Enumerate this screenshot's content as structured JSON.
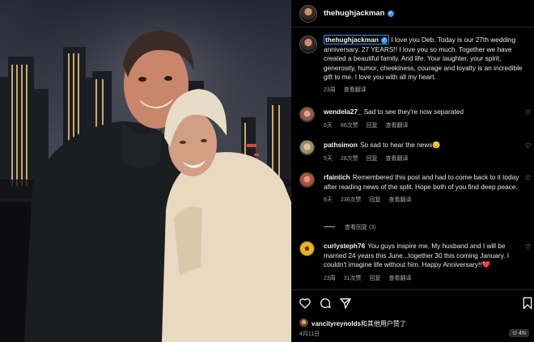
{
  "post": {
    "username": "thehughjackman",
    "caption": " I love you Deb. Today is our 27th wedding anniversary. 27 YEARS!! I love you so much. Together we have created a beautiful family. And life. Your laughter, your spirit, generosity, humor, cheekiness, courage and loyalty is an incredible gift to me. I love you with all my heart.",
    "caption_time": "23周",
    "caption_translate": "查看翻译"
  },
  "comments": [
    {
      "user": "wendela27_",
      "text": "Sad to see they're now separated",
      "time": "6天",
      "likes": "86次赞",
      "reply": "回复",
      "translate": "查看翻译"
    },
    {
      "user": "pathsimon",
      "text": "So sad to hear the news😔",
      "time": "5天",
      "likes": "28次赞",
      "reply": "回复",
      "translate": "查看翻译"
    },
    {
      "user": "rfaintich",
      "text": "Remembered this post and had to come back to it today after reading news of the split. Hope both of you find deep peace.",
      "time": "6天",
      "likes": "236次赞",
      "reply": "回复",
      "translate": "查看翻译"
    },
    {
      "user": "curlysteph76",
      "text": "You guys inspire me. My husband and I will be married 24 years this June...together 30 this coming January. I couldn't imagine life without him. Happy Anniversary!!❤️",
      "time": "23周",
      "likes": "31次赞",
      "reply": "回复",
      "translate": "查看翻译"
    }
  ],
  "view_replies": "查看回复 (3)",
  "likes_line": {
    "user": "vancityreynolds",
    "suffix": "和其他用户赞了"
  },
  "date": "4月11日",
  "watermark": "⊙ 4N",
  "icons": [
    "heart-icon",
    "comment-icon",
    "share-icon",
    "bookmark-icon"
  ],
  "colors": {
    "background": "#000000",
    "verified": "#3897f0",
    "meta": "#a8a8a8"
  }
}
